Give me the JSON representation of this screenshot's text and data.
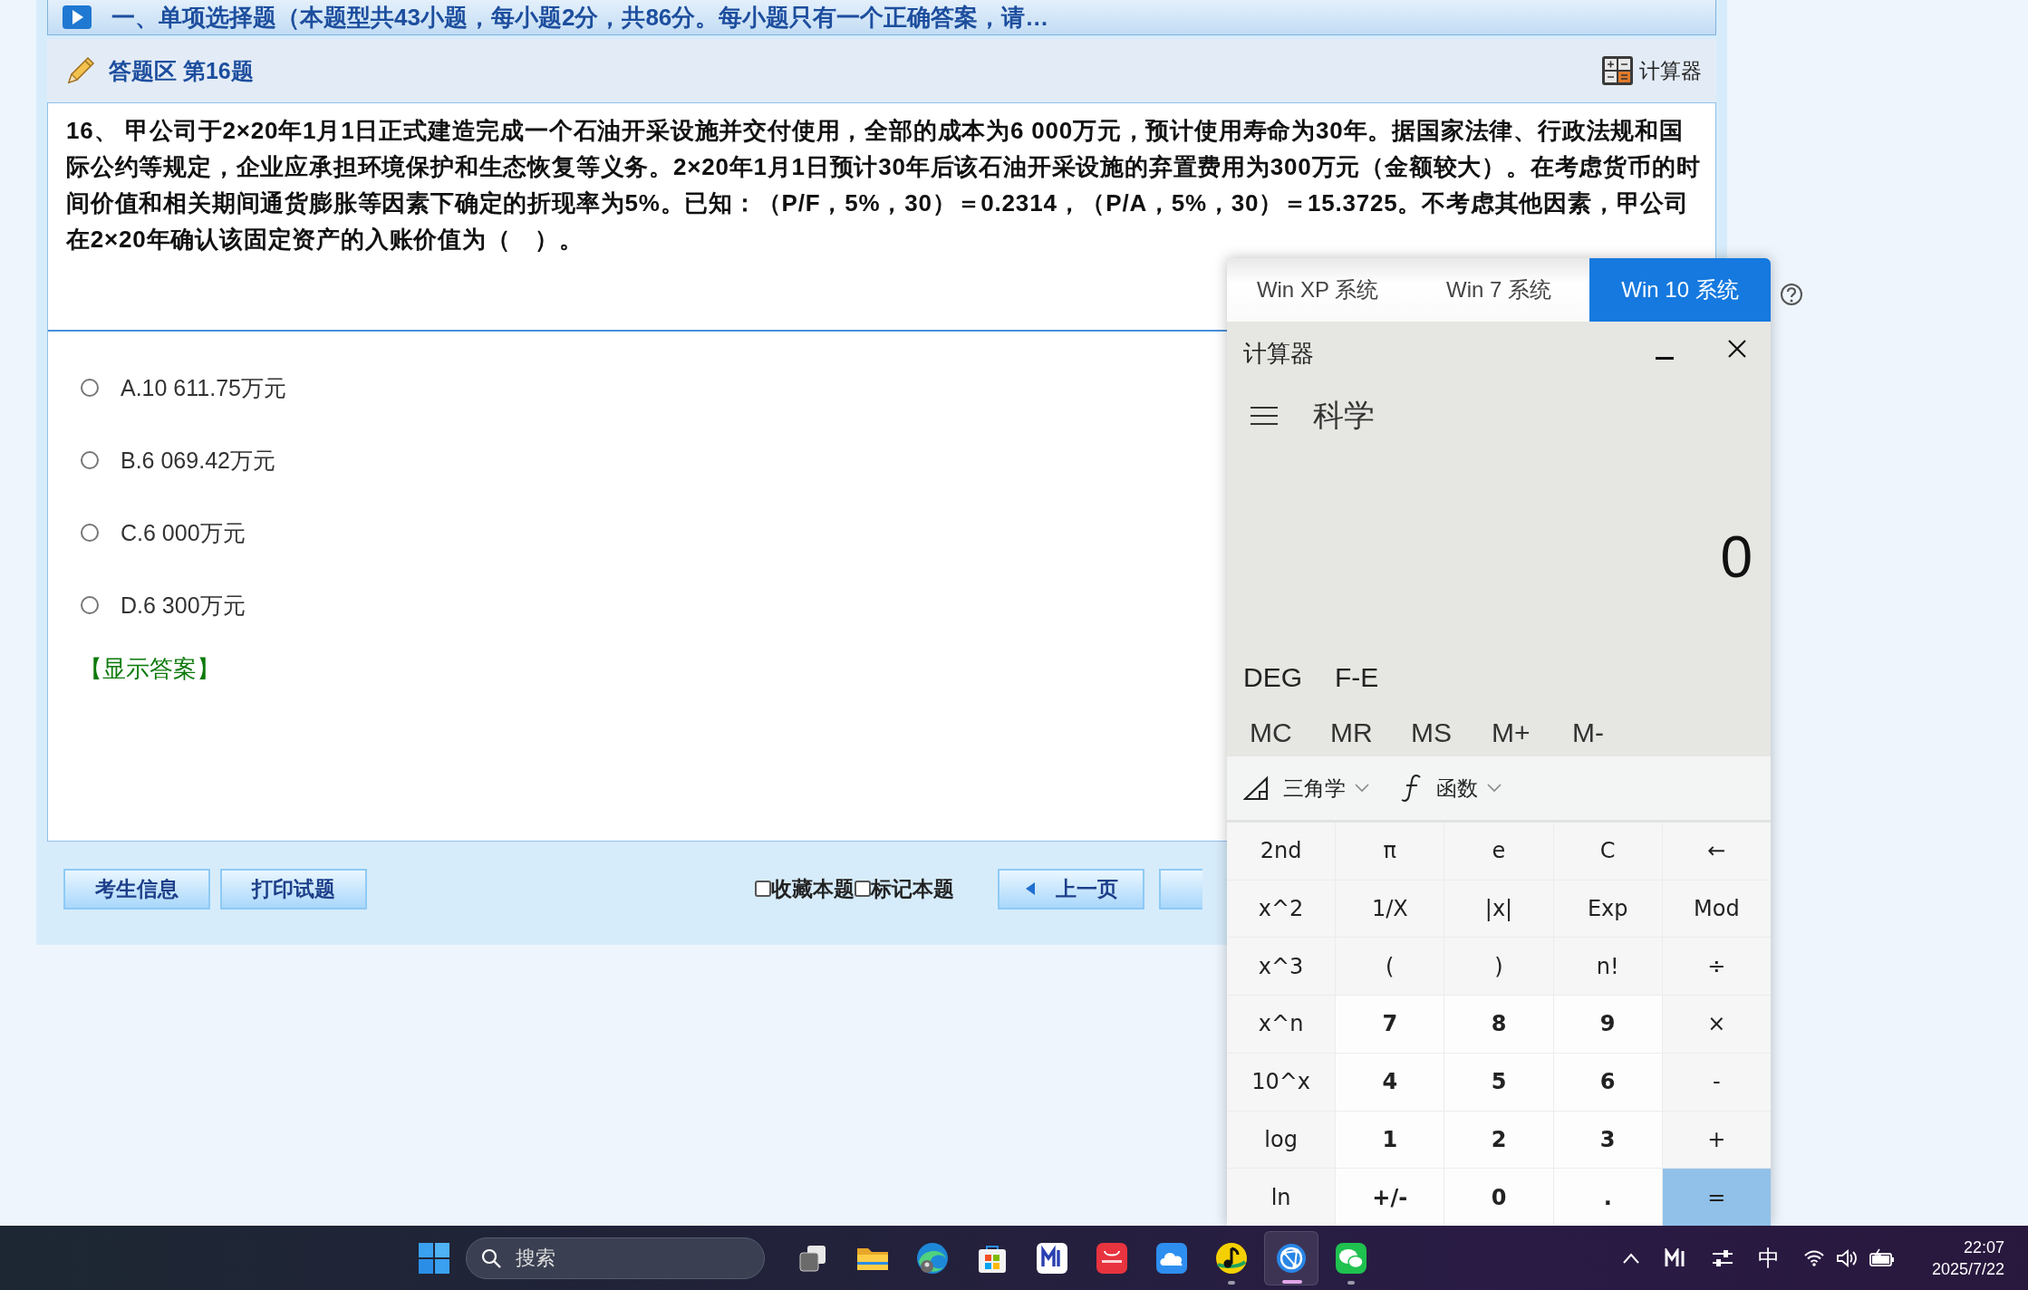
{
  "section_header": {
    "title": "一、单项选择题（本题型共43小题，每小题2分，共86分。每小题只有一个正确答案，请…"
  },
  "answer_area": {
    "title": "答题区 第16题",
    "calculator_button": "计算器"
  },
  "question": {
    "text": "16、 甲公司于2×20年1月1日正式建造完成一个石油开采设施并交付使用，全部的成本为6 000万元，预计使用寿命为30年。据国家法律、行政法规和国际公约等规定，企业应承担环境保护和生态恢复等义务。2×20年1月1日预计30年后该石油开采设施的弃置费用为300万元（金额较大）。在考虑货币的时间价值和相关期间通货膨胀等因素下确定的折现率为5%。已知：（P/F，5%，30）＝0.2314，（P/A，5%，30）＝15.3725。不考虑其他因素，甲公司在2×20年确认该固定资产的入账价值为（　）。"
  },
  "options": [
    {
      "label": "A.10 611.75万元",
      "selected": false
    },
    {
      "label": "B.6 069.42万元",
      "selected": false
    },
    {
      "label": "C.6 000万元",
      "selected": false
    },
    {
      "label": "D.6 300万元",
      "selected": false
    }
  ],
  "show_answer_link": "【显示答案】",
  "footer": {
    "buttons": [
      "考生信息",
      "打印试题"
    ],
    "checkboxes": [
      {
        "label": "收藏本题",
        "checked": false
      },
      {
        "label": "标记本题",
        "checked": false
      }
    ],
    "prev_button": "上一页"
  },
  "calculator": {
    "tabs": [
      {
        "label": "Win XP 系统",
        "selected": false
      },
      {
        "label": "Win 7 系统",
        "selected": false
      },
      {
        "label": "Win 10 系统",
        "selected": true
      }
    ],
    "title": "计算器",
    "mode": "科学",
    "display": "0",
    "angle_mode": "DEG",
    "fe_toggle": "F-E",
    "memory": [
      "MC",
      "MR",
      "MS",
      "M+",
      "M-"
    ],
    "menus": [
      {
        "label": "三角学",
        "kind": "trig"
      },
      {
        "label": "函数",
        "kind": "func"
      }
    ],
    "keys": [
      {
        "label": "2nd",
        "kind": "function"
      },
      {
        "label": "π",
        "kind": "function"
      },
      {
        "label": "e",
        "kind": "function"
      },
      {
        "label": "C",
        "kind": "function"
      },
      {
        "label": "←",
        "kind": "function"
      },
      {
        "label": "x^2",
        "kind": "function"
      },
      {
        "label": "1/X",
        "kind": "function"
      },
      {
        "label": "|x|",
        "kind": "function"
      },
      {
        "label": "Exp",
        "kind": "function"
      },
      {
        "label": "Mod",
        "kind": "function"
      },
      {
        "label": "x^3",
        "kind": "function"
      },
      {
        "label": "(",
        "kind": "function"
      },
      {
        "label": ")",
        "kind": "function"
      },
      {
        "label": "n!",
        "kind": "function"
      },
      {
        "label": "÷",
        "kind": "function"
      },
      {
        "label": "x^n",
        "kind": "function"
      },
      {
        "label": "7",
        "kind": "digit"
      },
      {
        "label": "8",
        "kind": "digit"
      },
      {
        "label": "9",
        "kind": "digit"
      },
      {
        "label": "×",
        "kind": "function"
      },
      {
        "label": "10^x",
        "kind": "function"
      },
      {
        "label": "4",
        "kind": "digit"
      },
      {
        "label": "5",
        "kind": "digit"
      },
      {
        "label": "6",
        "kind": "digit"
      },
      {
        "label": "-",
        "kind": "function"
      },
      {
        "label": "log",
        "kind": "function"
      },
      {
        "label": "1",
        "kind": "digit"
      },
      {
        "label": "2",
        "kind": "digit"
      },
      {
        "label": "3",
        "kind": "digit"
      },
      {
        "label": "+",
        "kind": "function"
      },
      {
        "label": "ln",
        "kind": "function"
      },
      {
        "label": "+/-",
        "kind": "digit"
      },
      {
        "label": "0",
        "kind": "digit"
      },
      {
        "label": ".",
        "kind": "digit"
      },
      {
        "label": "=",
        "kind": "equals"
      }
    ]
  },
  "taskbar": {
    "search": {
      "placeholder": "搜索"
    },
    "apps": [
      {
        "kind": "taskview",
        "running": false,
        "selected": false
      },
      {
        "kind": "folder",
        "running": false,
        "selected": false
      },
      {
        "kind": "edge",
        "running": false,
        "selected": false
      },
      {
        "kind": "store",
        "running": false,
        "selected": false
      },
      {
        "kind": "mapp",
        "running": false,
        "selected": false
      },
      {
        "kind": "huawei",
        "running": false,
        "selected": false
      },
      {
        "kind": "cloud",
        "running": false,
        "selected": false
      },
      {
        "kind": "music",
        "running": true,
        "selected": false
      },
      {
        "kind": "browser",
        "running": true,
        "selected": true
      },
      {
        "kind": "chat",
        "running": true,
        "selected": false
      }
    ],
    "ime": "中",
    "time": "22:07",
    "date": "2025/7/22"
  }
}
